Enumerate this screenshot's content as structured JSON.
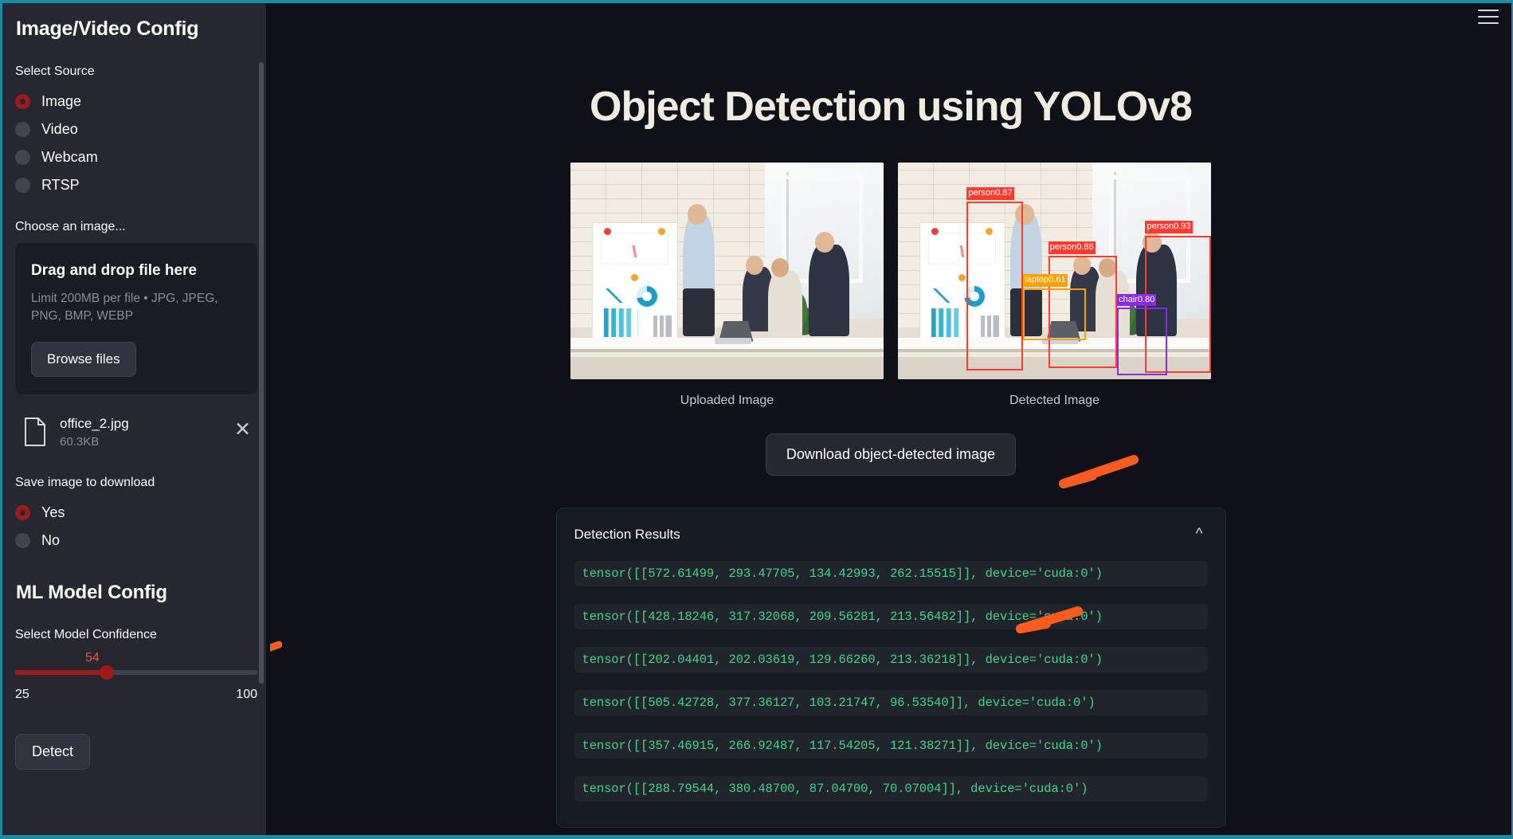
{
  "app": {
    "main_title": "Object Detection using YOLOv8"
  },
  "sidebar": {
    "title": "Image/Video Config",
    "select_source_label": "Select Source",
    "source_options": [
      {
        "label": "Image",
        "selected": true
      },
      {
        "label": "Video",
        "selected": false
      },
      {
        "label": "Webcam",
        "selected": false
      },
      {
        "label": "RTSP",
        "selected": false
      }
    ],
    "choose_image_label": "Choose an image...",
    "uploader": {
      "drag_title": "Drag and drop file here",
      "limits": "Limit 200MB per file • JPG, JPEG, PNG, BMP, WEBP",
      "browse_label": "Browse files"
    },
    "uploaded_file": {
      "icon": "file-icon",
      "name": "office_2.jpg",
      "size": "60.3KB",
      "remove_icon": "close-icon"
    },
    "save_image_label": "Save image to download",
    "save_options": [
      {
        "label": "Yes",
        "selected": true
      },
      {
        "label": "No",
        "selected": false
      }
    ],
    "model_config_title": "ML Model Config",
    "confidence": {
      "label": "Select Model Confidence",
      "value": "54",
      "min": "25",
      "max": "100",
      "accent": "#a01919",
      "value_color": "#e5564b"
    },
    "detect_button": "Detect",
    "scrollbar": "sidebar-scrollbar"
  },
  "header": {
    "menu_icon": "hamburger-menu-icon"
  },
  "images": {
    "uploaded_caption": "Uploaded Image",
    "detected_caption": "Detected Image"
  },
  "detections": [
    {
      "label": "person0.87",
      "color": "#ff3b30"
    },
    {
      "label": "person0.88",
      "color": "#ff3b30"
    },
    {
      "label": "person0.93",
      "color": "#ff3b30"
    },
    {
      "label": "laptop0.61",
      "color": "#ffa000"
    },
    {
      "label": "chair0.80",
      "color": "#8a2be2"
    }
  ],
  "download_button": "Download object-detected image",
  "results": {
    "title": "Detection Results",
    "collapse_icon": "chevron-up-icon",
    "rows": [
      "tensor([[572.61499, 293.47705, 134.42993, 262.15515]], device='cuda:0')",
      "tensor([[428.18246, 317.32068, 209.56281, 213.56482]], device='cuda:0')",
      "tensor([[202.04401, 202.03619, 129.66260, 213.36218]], device='cuda:0')",
      "tensor([[505.42728, 377.36127, 103.21747, 96.53540]], device='cuda:0')",
      "tensor([[357.46915, 266.92487, 117.54205, 121.38271]], device='cuda:0')",
      "tensor([[288.79544, 380.48700, 87.04700, 70.07004]], device='cuda:0')"
    ]
  },
  "annotations": {
    "arrow_color": "#ff5a1f",
    "arrow_1": "arrow-pointing-left-sidebar",
    "arrow_2": "arrow-pointing-left-detected-image",
    "arrow_3": "arrow-pointing-left-results"
  }
}
